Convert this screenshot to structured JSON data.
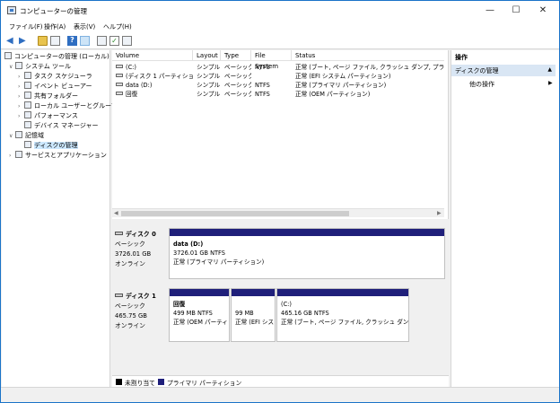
{
  "window": {
    "title": "コンピューターの管理",
    "minimize": "—",
    "maximize": "☐",
    "close": "✕"
  },
  "menu": [
    "ファイル(F)",
    "操作(A)",
    "表示(V)",
    "ヘルプ(H)"
  ],
  "tree": {
    "root": "コンピューターの管理 (ローカル)",
    "system_tools": "システム ツール",
    "task_scheduler": "タスク スケジューラ",
    "event_viewer": "イベント ビューアー",
    "shared_folders": "共有フォルダー",
    "local_users": "ローカル ユーザーとグループ",
    "performance": "パフォーマンス",
    "device_manager": "デバイス マネージャー",
    "storage": "記憶域",
    "disk_management": "ディスクの管理",
    "services_apps": "サービスとアプリケーション"
  },
  "volumes": {
    "columns": [
      "Volume",
      "Layout",
      "Type",
      "File System",
      "Status"
    ],
    "rows": [
      {
        "volume": "(C:)",
        "layout": "シンプル",
        "type": "ベーシック",
        "fs": "NTFS",
        "status": "正常 (ブート, ページ ファイル, クラッシュ ダンプ, プライマリ パー"
      },
      {
        "volume": "(ディスク 1 パーティション 2)",
        "layout": "シンプル",
        "type": "ベーシック",
        "fs": "",
        "status": "正常 (EFI システム パーティション)"
      },
      {
        "volume": "data (D:)",
        "layout": "シンプル",
        "type": "ベーシック",
        "fs": "NTFS",
        "status": "正常 (プライマリ パーティション)"
      },
      {
        "volume": "回復",
        "layout": "シンプル",
        "type": "ベーシック",
        "fs": "NTFS",
        "status": "正常 (OEM パーティション)"
      }
    ]
  },
  "disks": [
    {
      "name": "ディスク 0",
      "kind": "ベーシック",
      "size": "3726.01 GB",
      "state": "オンライン",
      "partitions": [
        {
          "title": "data  (D:)",
          "size": "3726.01 GB NTFS",
          "status": "正常 (プライマリ パーティション)"
        }
      ]
    },
    {
      "name": "ディスク 1",
      "kind": "ベーシック",
      "size": "465.75 GB",
      "state": "オンライン",
      "partitions": [
        {
          "title": "回復",
          "size": "499 MB NTFS",
          "status": "正常 (OEM パーティ"
        },
        {
          "title": "",
          "size": "99 MB",
          "status": "正常 (EFI シス"
        },
        {
          "title": "(C:)",
          "size": "465.16 GB NTFS",
          "status": "正常 (ブート, ページ ファイル, クラッシュ ダンプ, プ"
        }
      ]
    }
  ],
  "legend": {
    "unallocated": "未割り当て",
    "primary": "プライマリ パーティション",
    "unallocated_color": "#000000",
    "primary_color": "#1f1f7a"
  },
  "actions": {
    "header": "操作",
    "selected": "ディスクの管理",
    "other": "他の操作"
  }
}
